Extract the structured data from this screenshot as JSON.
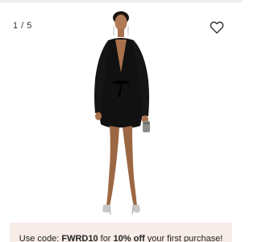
{
  "gallery": {
    "counter": "1 / 5",
    "favorite_icon": "heart-outline-icon"
  },
  "product_image": {
    "subject": "model wearing black long-sleeve wrap mini dress with tie waist, holding small clutch, silver heels",
    "dress_color": "#111111"
  },
  "promo": {
    "prefix": "Use code: ",
    "code": "FWRD10",
    "mid": " for ",
    "discount": "10% off",
    "suffix": " your first purchase!",
    "background": "#f7ece8"
  }
}
